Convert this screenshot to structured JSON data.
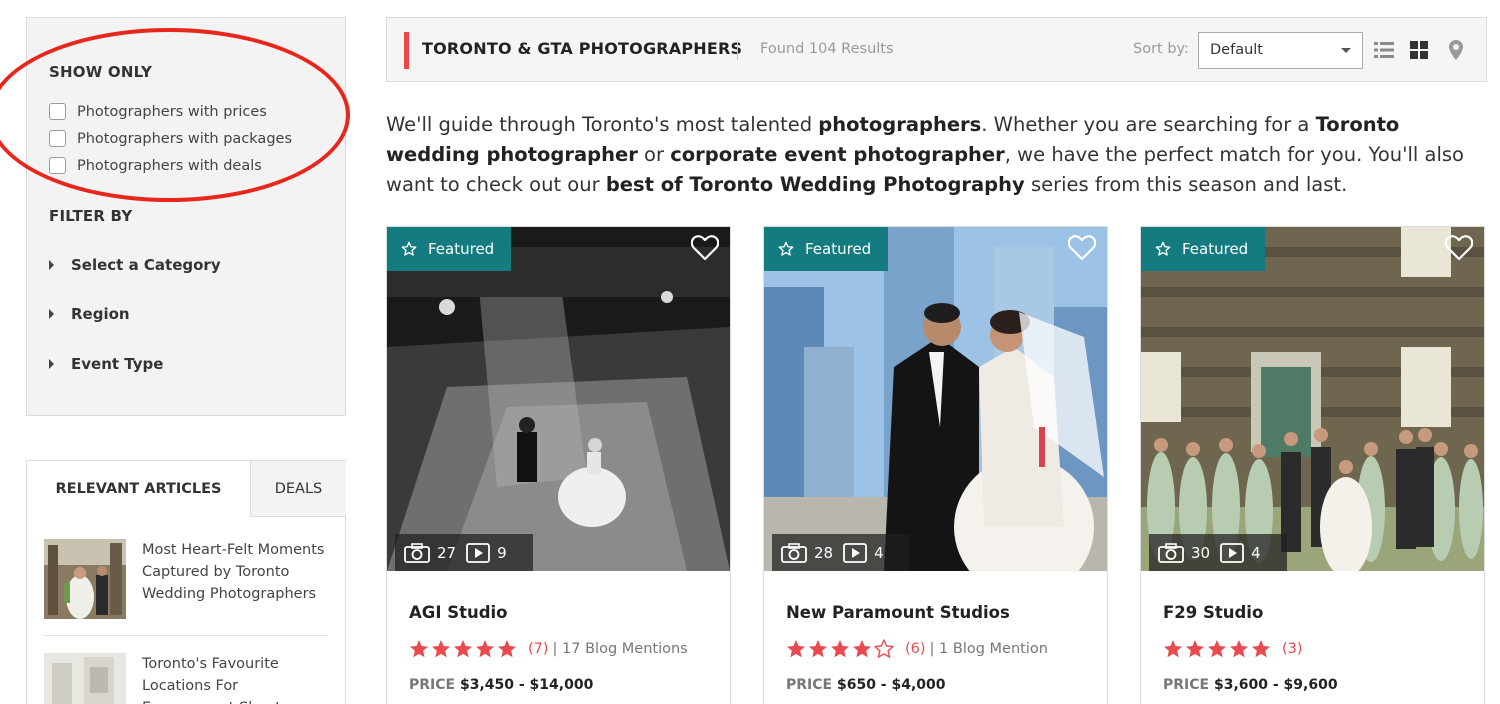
{
  "sidebar": {
    "show_only": {
      "heading": "SHOW ONLY",
      "options": [
        {
          "label": "Photographers with prices",
          "checked": false
        },
        {
          "label": "Photographers with packages",
          "checked": false
        },
        {
          "label": "Photographers with deals",
          "checked": false
        }
      ]
    },
    "filter_by": {
      "heading": "FILTER BY",
      "items": [
        "Select a Category",
        "Region",
        "Event Type"
      ]
    },
    "articles": {
      "tab_articles": "RELEVANT ARTICLES",
      "tab_deals": "DEALS",
      "items": [
        {
          "title": "Most Heart-Felt Moments Captured by Toronto Wedding Photographers"
        },
        {
          "title": "Toronto's Favourite Locations For Engagement Shoots"
        }
      ]
    }
  },
  "header": {
    "title": "TORONTO & GTA PHOTOGRAPHERS",
    "results": "Found 104 Results",
    "sort_label": "Sort by:",
    "sort_value": "Default",
    "view_icons": [
      "list-view-icon",
      "grid-view-icon",
      "map-pin-icon"
    ]
  },
  "intro": {
    "p1": "We'll guide through Toronto's most talented ",
    "b1": "photographers",
    "p2": ". Whether you are searching for a ",
    "b2": "Toronto wedding photographer",
    "p3": " or ",
    "b3": "corporate event photographer",
    "p4": ", we have the perfect match for you. You'll also want to check out our ",
    "b4": "best of Toronto Wedding Photography",
    "p5": " series from this season and last."
  },
  "cards": [
    {
      "badge": "Featured",
      "photos": "27",
      "videos": "9",
      "name": "AGI Studio",
      "rating": 5,
      "reviews": "(7)",
      "mentions": "| 17 Blog Mentions",
      "price_label": "PRICE",
      "price": "$3,450 - $14,000"
    },
    {
      "badge": "Featured",
      "photos": "28",
      "videos": "4",
      "name": "New Paramount Studios",
      "rating": 4.5,
      "reviews": "(6)",
      "mentions": "| 1 Blog Mention",
      "price_label": "PRICE",
      "price": "$650 - $4,000"
    },
    {
      "badge": "Featured",
      "photos": "30",
      "videos": "4",
      "name": "F29 Studio",
      "rating": 5,
      "reviews": "(3)",
      "mentions": "",
      "price_label": "PRICE",
      "price": "$3,600 - $9,600"
    }
  ],
  "colors": {
    "accent": "#ef4547",
    "featured": "#147c80",
    "star": "#e84a4f",
    "annotation": "#e8261b"
  }
}
